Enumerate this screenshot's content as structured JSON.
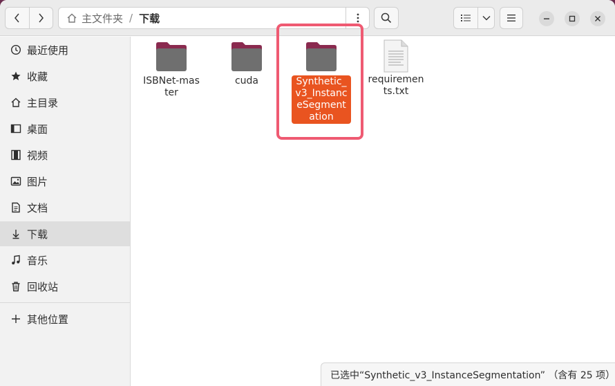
{
  "header": {
    "breadcrumb": [
      {
        "label": "主文件夹",
        "icon": "home-icon"
      },
      {
        "label": "下载"
      }
    ]
  },
  "sidebar": {
    "items": [
      {
        "label": "最近使用",
        "icon": "clock-icon"
      },
      {
        "label": "收藏",
        "icon": "star-icon"
      },
      {
        "label": "主目录",
        "icon": "home-icon"
      },
      {
        "label": "桌面",
        "icon": "desktop-icon"
      },
      {
        "label": "视频",
        "icon": "video-icon"
      },
      {
        "label": "图片",
        "icon": "image-icon"
      },
      {
        "label": "文档",
        "icon": "document-icon"
      },
      {
        "label": "下载",
        "icon": "download-icon",
        "active": true
      },
      {
        "label": "音乐",
        "icon": "music-icon"
      },
      {
        "label": "回收站",
        "icon": "trash-icon"
      },
      {
        "label": "其他位置",
        "icon": "plus-icon"
      }
    ]
  },
  "files": [
    {
      "name": "ISBNet-master",
      "type": "folder"
    },
    {
      "name": "cuda",
      "type": "folder"
    },
    {
      "name": "Synthetic_v3_InstanceSegmentation",
      "type": "folder",
      "selected": true
    },
    {
      "name": "requirements.txt",
      "type": "text-file"
    }
  ],
  "status": {
    "text": "已选中“Synthetic_v3_InstanceSegmentation” （含有 25 项）"
  },
  "colors": {
    "selection": "#e95420",
    "highlight_box": "#ef5a72",
    "folder_tab": "#8a2a4f",
    "folder_body": "#6f6f6f"
  }
}
